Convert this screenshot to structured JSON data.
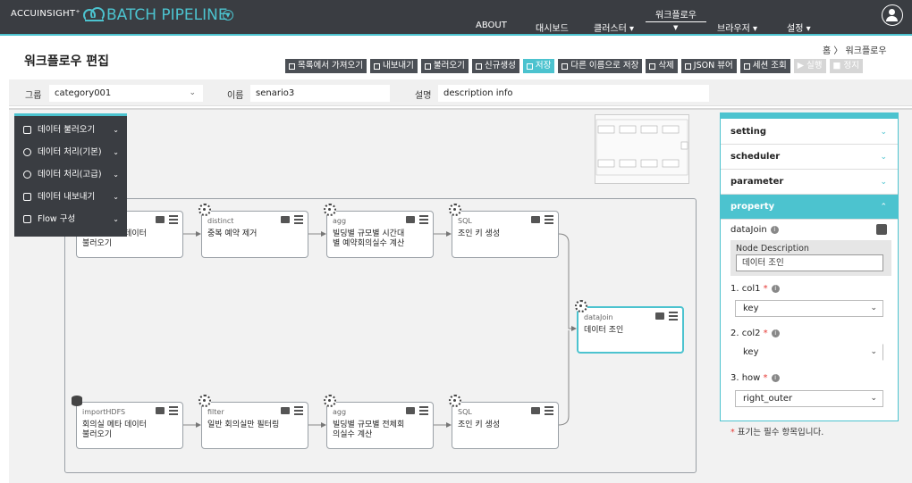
{
  "header": {
    "brand_small": "ACCUINSIGHT⁺",
    "brand_main": "BATCH PIPELINE",
    "nav": [
      {
        "label": "ABOUT"
      },
      {
        "label": "대시보드"
      },
      {
        "label": "클러스터 ▾"
      },
      {
        "label": "워크플로우",
        "active": true
      },
      {
        "label": "브라우저 ▾"
      },
      {
        "label": "설정 ▾"
      }
    ]
  },
  "page": {
    "title": "워크플로우 편집",
    "breadcrumb": "홈  〉 워크플로우"
  },
  "toolbar": [
    {
      "label": "목록에서 가져오기"
    },
    {
      "label": "내보내기"
    },
    {
      "label": "불러오기"
    },
    {
      "label": "신규생성"
    },
    {
      "label": "저장",
      "style": "primary"
    },
    {
      "label": "다른 이름으로 저장"
    },
    {
      "label": "삭제"
    },
    {
      "label": "JSON 뷰어"
    },
    {
      "label": "세션 조회"
    },
    {
      "label": "실행",
      "disabled": true
    },
    {
      "label": "정지",
      "disabled": true
    }
  ],
  "filters": {
    "group_label": "그룹",
    "group_value": "category001",
    "name_label": "이름",
    "name_value": "senario3",
    "desc_label": "설명",
    "desc_value": "description info"
  },
  "palette_menu": [
    {
      "label": "데이터 불러오기",
      "icon": "database-icon"
    },
    {
      "label": "데이터 처리(기본)",
      "icon": "gear-icon"
    },
    {
      "label": "데이터 처리(고급)",
      "icon": "gear-icon"
    },
    {
      "label": "데이터 내보내기",
      "icon": "database-icon"
    },
    {
      "label": "Flow 구성",
      "icon": "flow-icon"
    }
  ],
  "nodes": {
    "n1": {
      "type": "",
      "desc": "회의실 예약 데이터 불러오기"
    },
    "n2": {
      "type": "distinct",
      "desc": "중복 예약 제거"
    },
    "n3": {
      "type": "agg",
      "desc": "빌딩별 규모별 시간대별 예약회의실수 계산"
    },
    "n4": {
      "type": "SQL",
      "desc": "조인 키 생성"
    },
    "n5": {
      "type": "dataJoin",
      "desc": "데이터 조인"
    },
    "n6": {
      "type": "importHDFS",
      "desc": "회의실 메타 데이터 불러오기"
    },
    "n7": {
      "type": "filter",
      "desc": "일반 회의실만 필터링"
    },
    "n8": {
      "type": "agg",
      "desc": "빌딩별 규모별 전체회의실수 계산"
    },
    "n9": {
      "type": "SQL",
      "desc": "조인 키 생성"
    }
  },
  "panel": {
    "sections": [
      "setting",
      "scheduler",
      "parameter",
      "property"
    ],
    "node_name": "dataJoin",
    "node_desc_title": "Node Description",
    "node_desc_value": "데이터 조인",
    "fields": [
      {
        "label": "1. col1",
        "value": "key"
      },
      {
        "label": "2. col2",
        "value": "key"
      },
      {
        "label": "3. how",
        "value": "right_outer"
      }
    ],
    "footnote": "표기는 필수 항목입니다."
  }
}
